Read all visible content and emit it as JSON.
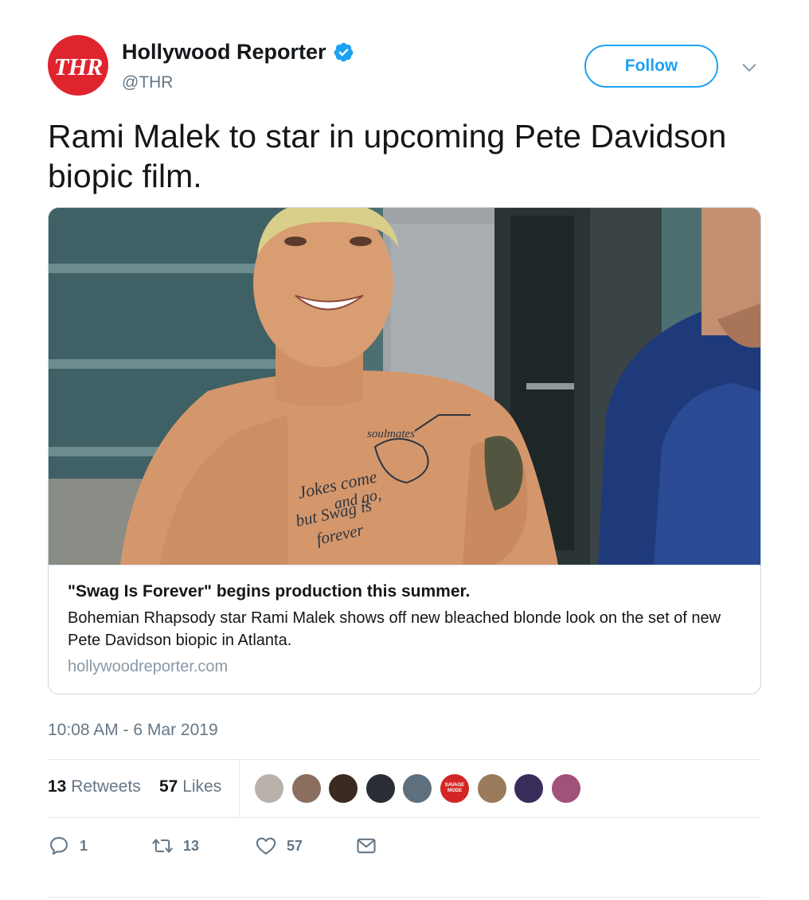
{
  "author": {
    "avatar_text": "THR",
    "display_name": "Hollywood Reporter",
    "handle": "@THR",
    "verified": true
  },
  "follow_label": "Follow",
  "tweet_text": "Rami Malek to star in upcoming Pete Davidson biopic film.",
  "card": {
    "title": "\"Swag Is Forever\" begins production this summer.",
    "description": "Bohemian Rhapsody star Rami Malek shows off new bleached blonde look on the set of new Pete Davidson biopic in Atlanta.",
    "domain": "hollywoodreporter.com",
    "image_tattoo_text": [
      "Jokes come",
      "and go,",
      "but Swag is",
      "forever",
      "soulmates"
    ]
  },
  "timestamp": "10:08 AM - 6 Mar 2019",
  "stats": {
    "retweets_count": "13",
    "retweets_label": "Retweets",
    "likes_count": "57",
    "likes_label": "Likes",
    "likers": [
      {
        "color": "#b9b2ab"
      },
      {
        "color": "#8a6f5e"
      },
      {
        "color": "#3b2a22"
      },
      {
        "color": "#2a2d33"
      },
      {
        "color": "#5e6f7d"
      },
      {
        "color": "#d42525",
        "label": "SAVAGE MODE"
      },
      {
        "color": "#9a7b5c"
      },
      {
        "color": "#3a2c5a"
      },
      {
        "color": "#a0527a"
      }
    ]
  },
  "actions": {
    "reply_count": "1",
    "retweet_count": "13",
    "like_count": "57"
  },
  "colors": {
    "accent": "#1da1f2",
    "brand_red": "#e0242e",
    "muted": "#657786"
  },
  "icons": {
    "verified": "verified-badge-icon",
    "caret": "chevron-down-icon",
    "reply": "reply-icon",
    "retweet": "retweet-icon",
    "like": "heart-icon",
    "dm": "envelope-icon"
  }
}
